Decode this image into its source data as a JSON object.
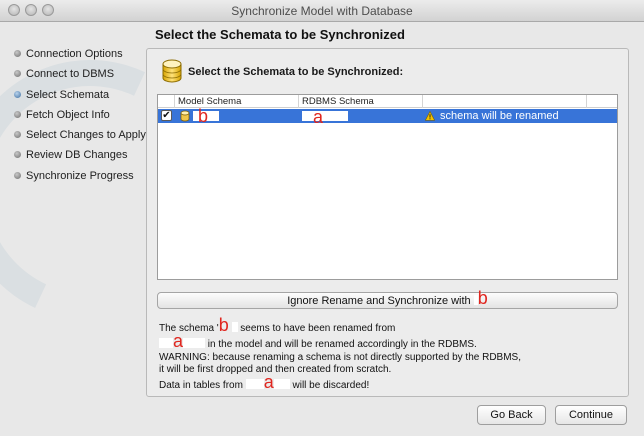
{
  "window": {
    "title": "Synchronize Model with Database"
  },
  "sidebar": {
    "steps": [
      {
        "label": "Connection Options"
      },
      {
        "label": "Connect to DBMS"
      },
      {
        "label": "Select Schemata"
      },
      {
        "label": "Fetch Object Info"
      },
      {
        "label": "Select Changes to Apply"
      },
      {
        "label": "Review DB Changes"
      },
      {
        "label": "Synchronize Progress"
      }
    ]
  },
  "page": {
    "title": "Select the Schemata to be Synchronized"
  },
  "panel": {
    "heading": "Select the Schemata to be Synchronized:",
    "table": {
      "columns": [
        "Model Schema",
        "RDBMS Schema",
        ""
      ],
      "rows": [
        {
          "checked": true,
          "model_schema": "b",
          "rdbms_schema": "a",
          "note": "schema will be renamed"
        }
      ]
    },
    "ignore_button": {
      "label": "Ignore Rename and Synchronize with",
      "name": "b"
    },
    "message": {
      "l1_pre": "The schema '",
      "l1_name": "b",
      "l1_post": "seems to have been renamed from",
      "l2_name": "a",
      "l2_post": "in the model and will be renamed accordingly in the RDBMS.",
      "l3": "WARNING: because renaming a schema is not directly supported by the RDBMS,",
      "l4": "it will be first dropped and then created from scratch.",
      "l5_pre": "Data in tables from",
      "l5_name": "a",
      "l5_post": "will be discarded!"
    }
  },
  "footer": {
    "back_label": "Go Back",
    "continue_label": "Continue"
  },
  "colors": {
    "selection": "#3874d8",
    "annotation_red": "#e0261f",
    "warning_yellow": "#f2c200"
  }
}
